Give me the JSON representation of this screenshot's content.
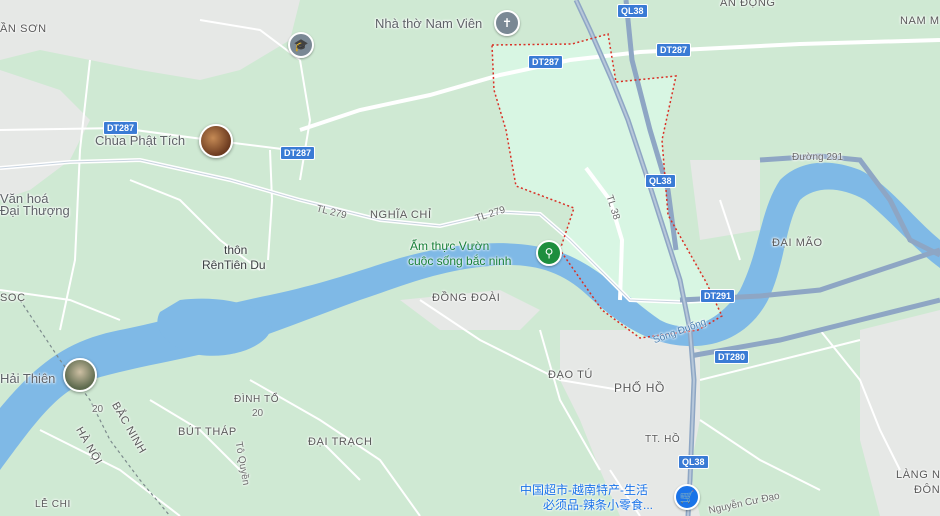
{
  "map": {
    "colors": {
      "land": "#cfe9d3",
      "urban": "#e8eaed",
      "water": "#7fb9e6",
      "road": "#ffffff",
      "highway": "#8ea6c4",
      "boundary": "#d93025",
      "highlight": "#d7f5e2"
    },
    "area_labels": {
      "an_dong": "AN ĐỘNG",
      "nam_m": "NAM M",
      "an_son": "ẦN SƠN",
      "dai_mao": "ĐẠI MÃO",
      "dong_doai": "ĐỒNG ĐOÀI",
      "dao_tu": "ĐẠO TÚ",
      "dinh_to": "ĐÌNH TỔ",
      "but_thap": "BÚT THÁP",
      "dai_trach": "ĐẠI TRẠCH",
      "tt_ho": "TT. HỒ",
      "le_chi": "LỄ CHI",
      "soc": "SOC",
      "lang_n": "LÀNG N",
      "dong_n": "ĐÔN",
      "nghia_chi": "NGHĨA CHỈ",
      "pho_ho": "PHỐ HỒ",
      "bac_ninh": "BẮC NINH",
      "ha_noi": "HÀ NỘI"
    },
    "place_labels": {
      "thon": "thôn",
      "ren_tien_du": "RênTiên Du",
      "van_hoa": "Văn hoá",
      "dai_thuong": "Đại Thượng",
      "hai_thien": "Hải Thiên"
    },
    "pois": {
      "nha_tho": {
        "name": "Nhà thờ Nam Viên",
        "icon": "church-icon"
      },
      "chua": {
        "name": "Chùa Phật Tích"
      },
      "am_thuc": {
        "name": "Ẩm thực Vườn cuộc sống bắc ninh",
        "line1": "Ẩm thực Vườn",
        "line2": "cuộc sống bắc ninh",
        "icon": "restaurant-icon"
      },
      "sieu_thi": {
        "name": "中国超市-越南特产-生活必须品-辣条小零食...",
        "line1": "中国超市-越南特产-生活",
        "line2": "必须品-辣条小零食...",
        "icon": "shopping-cart-icon"
      },
      "school": {
        "icon": "school-icon"
      }
    },
    "roads": {
      "dt287": "DT287",
      "ql38": "QL38",
      "dt291": "DT291",
      "dt280": "DT280",
      "tl279": "TL 279",
      "tl38": "TL 38",
      "duong291": "Đường 291",
      "nguyen_cu_dao": "Nguyễn Cư Đạo",
      "to_quyen": "Tô Quyền",
      "r20": "20"
    },
    "water": {
      "song_duong": "Sông Đuống"
    }
  }
}
